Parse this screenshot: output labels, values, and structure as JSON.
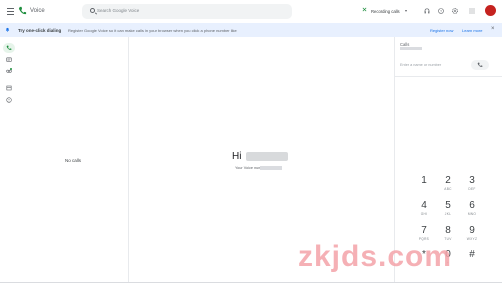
{
  "app": {
    "title": "Voice"
  },
  "search": {
    "placeholder": "Search Google Voice"
  },
  "header": {
    "recording_label": "Recording calls"
  },
  "banner": {
    "title": "Try one-click dialing",
    "text": "Register Google Voice so it can make calls in your browser when you click a phone number like",
    "register_label": "Register now",
    "learn_more_label": "Learn more",
    "close": "×"
  },
  "calls": {
    "empty_label": "No calls"
  },
  "main": {
    "greeting": "Hi",
    "your_number_label": "Your Voice number"
  },
  "dialer": {
    "title": "Calls",
    "input_placeholder": "Enter a name or number",
    "keys": [
      {
        "digit": "1",
        "letters": ""
      },
      {
        "digit": "2",
        "letters": "ABC"
      },
      {
        "digit": "3",
        "letters": "DEF"
      },
      {
        "digit": "4",
        "letters": "GHI"
      },
      {
        "digit": "5",
        "letters": "JKL"
      },
      {
        "digit": "6",
        "letters": "MNO"
      },
      {
        "digit": "7",
        "letters": "PQRS"
      },
      {
        "digit": "8",
        "letters": "TUV"
      },
      {
        "digit": "9",
        "letters": "WXYZ"
      },
      {
        "digit": "*",
        "letters": ""
      },
      {
        "digit": "0",
        "letters": "+"
      },
      {
        "digit": "#",
        "letters": ""
      }
    ]
  },
  "watermark": {
    "text": "zkjds.com"
  },
  "colors": {
    "accent": "#1a73e8",
    "brand_green": "#1e8e3e",
    "banner_bg": "#e8f0fe",
    "avatar": "#c5221f"
  },
  "icons": [
    "menu-icon",
    "voice-logo-icon",
    "search-icon",
    "recording-icon",
    "headset-icon",
    "help-icon",
    "settings-icon",
    "apps-grid-icon",
    "bell-icon",
    "phone-icon",
    "message-icon",
    "voicemail-icon",
    "archive-icon",
    "spam-icon"
  ]
}
